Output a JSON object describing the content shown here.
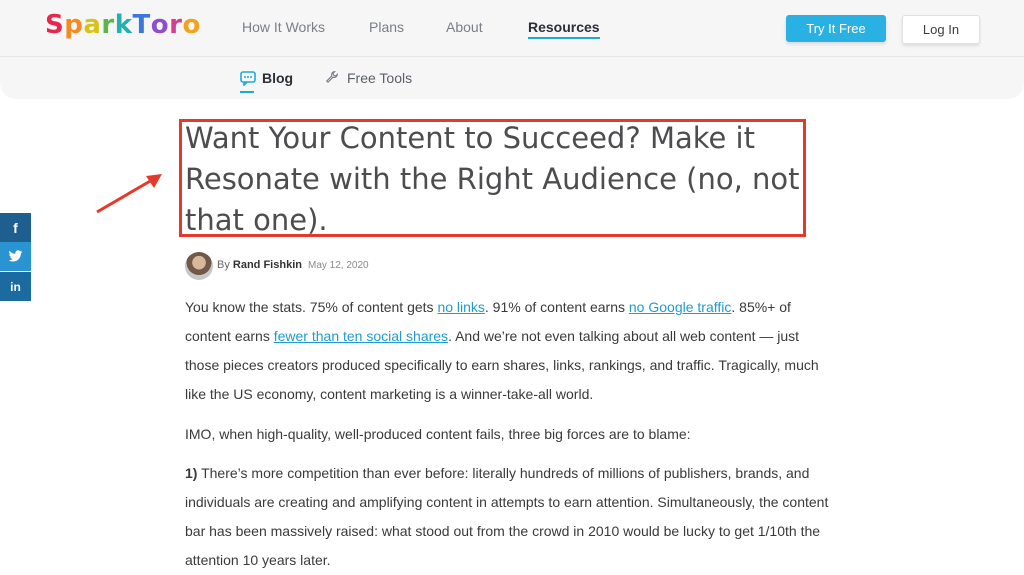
{
  "header": {
    "logo": "SparkToro",
    "logo_letters": [
      "S",
      "p",
      "a",
      "r",
      "k",
      "T",
      "o",
      "r",
      "o"
    ],
    "logo_colors": [
      "#e6264f",
      "#f58a1f",
      "#d7c218",
      "#5ab64a",
      "#22b1b0",
      "#3b78d8",
      "#8b4fd0",
      "#d33f8f",
      "#f2a21b"
    ],
    "nav": [
      "How It Works",
      "Plans",
      "About",
      "Resources"
    ],
    "try_button": "Try It Free",
    "login_button": "Log In"
  },
  "subnav": {
    "blog": "Blog",
    "free_tools": "Free Tools"
  },
  "article": {
    "title": "Want Your Content to Succeed? Make it Resonate with the Right Audience (no, not that one).",
    "by": "By",
    "author": "Rand Fishkin",
    "date": "May 12, 2020",
    "p1": {
      "t1": "You know the stats. 75% of content gets ",
      "l1": "no links",
      "t2": ". 91% of content earns ",
      "l2": "no Google traffic",
      "t3": ". 85%+ of content earns ",
      "l3": "fewer than ten social shares",
      "t4": ". And we’re not even talking about all web content — just those pieces creators produced specifically to earn shares, links, rankings, and traffic. Tragically, much like the US economy, content marketing is a winner-take-all world."
    },
    "p2": "IMO, when high-quality, well-produced content fails, three big forces are to blame:",
    "p3_num": "1)",
    "p3": " There’s more competition than ever before: literally hundreds of millions of publishers, brands, and individuals are creating and amplifying content in attempts to earn attention. Simultaneously, the content bar has been massively raised: what stood out from the crowd in 2010 would be lucky to get 1/10th the attention 10 years later."
  },
  "share": {
    "facebook": "f",
    "linkedin": "in"
  },
  "colors": {
    "accent": "#2ab1e3",
    "highlight": "#e53a2b",
    "link": "#1f9ccf"
  }
}
